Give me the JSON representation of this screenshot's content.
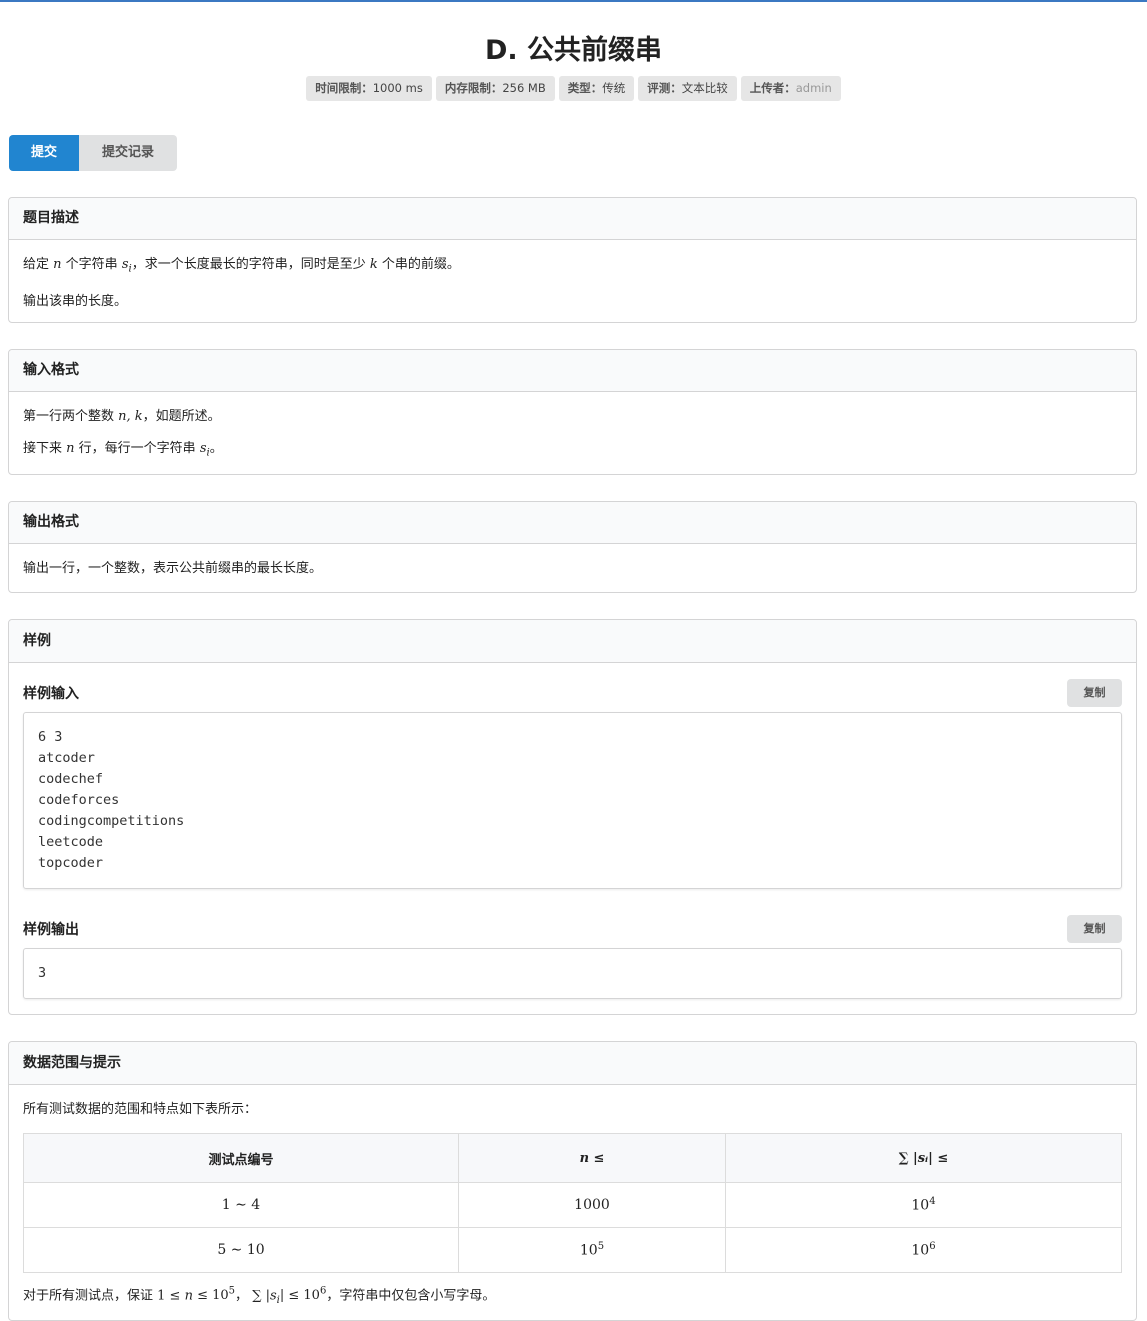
{
  "problem": {
    "title": "D. 公共前缀串",
    "meta": [
      {
        "label": "时间限制：",
        "value": "1000 ms"
      },
      {
        "label": "内存限制：",
        "value": "256 MB"
      },
      {
        "label": "类型：",
        "value": "传统"
      },
      {
        "label": "评测：",
        "value": "文本比较"
      },
      {
        "label": "上传者：",
        "value": "admin"
      }
    ]
  },
  "tabs": {
    "submit": "提交",
    "records": "提交记录"
  },
  "description": {
    "heading": "题目描述",
    "p1_a": "给定",
    "p1_n": "n",
    "p1_b": "个字符串",
    "p1_s": "s",
    "p1_i": "i",
    "p1_c": "，求一个长度最长的字符串，同时是至少",
    "p1_k": "k",
    "p1_d": "个串的前缀。",
    "p2": "输出该串的长度。"
  },
  "input_format": {
    "heading": "输入格式",
    "l1_a": "第一行两个整数",
    "l1_math": "n, k",
    "l1_b": "，如题所述。",
    "l2_a": "接下来",
    "l2_n": "n",
    "l2_b": "行，每行一个字符串",
    "l2_s": "s",
    "l2_i": "i",
    "l2_c": "。"
  },
  "output_format": {
    "heading": "输出格式",
    "text": "输出一行，一个整数，表示公共前缀串的最长长度。"
  },
  "samples": {
    "heading": "样例",
    "input_title": "样例输入",
    "output_title": "样例输出",
    "copy_label": "复制",
    "input_text": "6 3\natcoder\ncodechef\ncodeforces\ncodingcompetitions\nleetcode\ntopcoder",
    "output_text": "3"
  },
  "constraints": {
    "heading": "数据范围与提示",
    "intro": "所有测试数据的范围和特点如下表所示：",
    "headers": [
      "测试点编号",
      "n ≤",
      "∑ |sᵢ| ≤"
    ],
    "rows": [
      {
        "range": "1 ∼ 4",
        "n": "1000",
        "sum_base": "10",
        "sum_exp": "4"
      },
      {
        "range": "5 ∼ 10",
        "n_base": "10",
        "n_exp": "5",
        "sum_base": "10",
        "sum_exp": "6"
      }
    ],
    "footer_a": "对于所有测试点，保证",
    "footer_b": "，",
    "footer_c": "，字符串中仅包含小写字母。"
  },
  "colors": {
    "accent": "#2185d0",
    "top_border": "#3b78c2",
    "tag_bg": "#e6e6e6"
  }
}
